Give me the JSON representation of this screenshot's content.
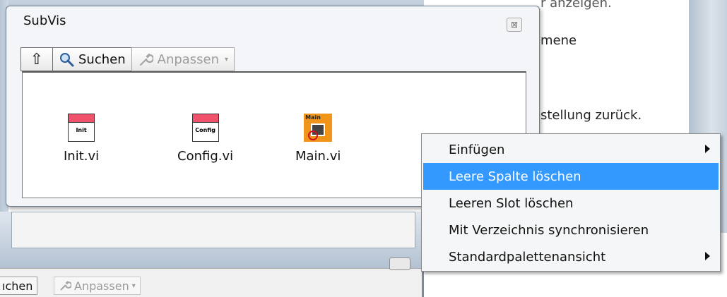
{
  "background": {
    "right_texts": [
      "r anzeigen.",
      "mene",
      "stellung zurück."
    ],
    "bottom_toolbar": {
      "search_fragment": "ıchen",
      "customize_label": "Anpassen"
    }
  },
  "subvis": {
    "title": "SubVis",
    "close_glyph": "⊠",
    "toolbar": {
      "up_glyph": "⇧",
      "search_label": "Suchen",
      "customize_label": "Anpassen",
      "caret": "▾"
    },
    "items": [
      {
        "icon_label": "Init",
        "caption": "Init.vi"
      },
      {
        "icon_label": "Config",
        "caption": "Config.vi"
      },
      {
        "icon_label": "Main",
        "caption": "Main.vi"
      }
    ]
  },
  "context_menu": {
    "items": [
      {
        "label": "Einfügen",
        "submenu": true
      },
      {
        "label": "Leere Spalte löschen",
        "highlighted": true
      },
      {
        "label": "Leeren Slot löschen"
      },
      {
        "label": "Mit Verzeichnis synchronisieren"
      },
      {
        "label": "Standardpalettenansicht",
        "submenu": true
      }
    ]
  },
  "colors": {
    "menu_highlight": "#3399ff",
    "vi_header": "#f0526c",
    "main_icon": "#f0951a"
  },
  "icons": [
    "up-arrow-icon",
    "magnifier-icon",
    "wrench-icon",
    "close-icon",
    "submenu-arrow-icon"
  ]
}
